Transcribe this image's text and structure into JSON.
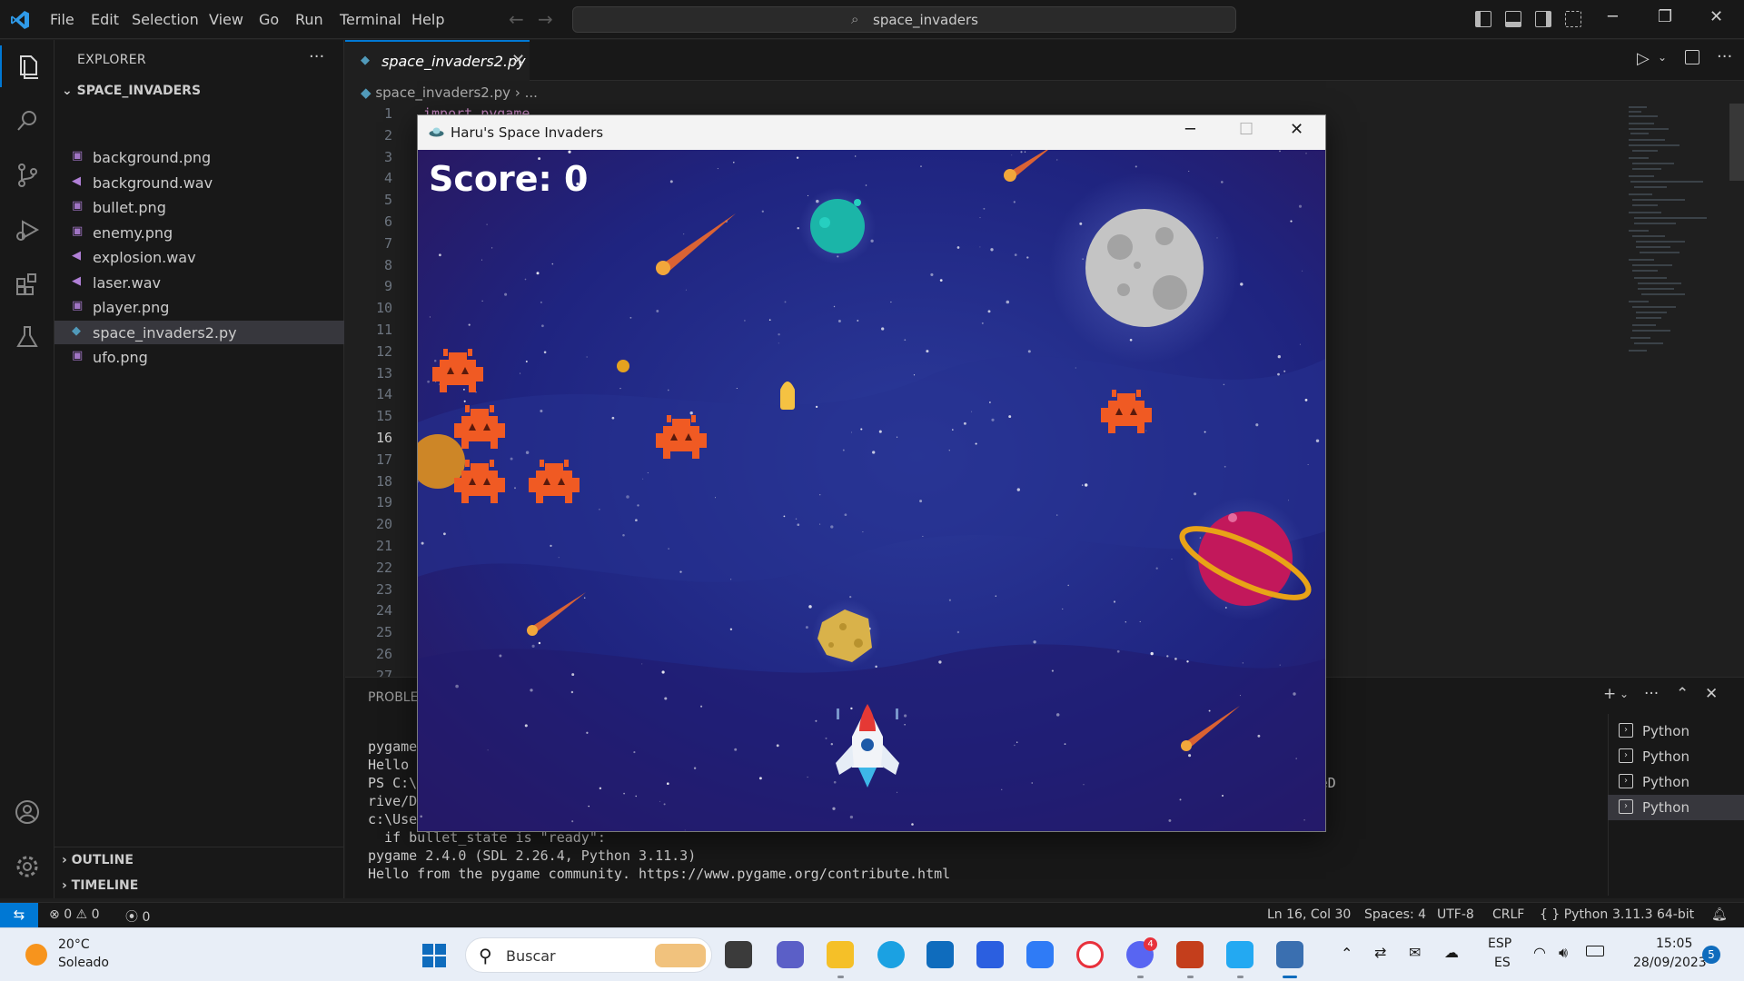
{
  "titlebar": {
    "menu": [
      "File",
      "Edit",
      "Selection",
      "View",
      "Go",
      "Run",
      "Terminal",
      "Help"
    ],
    "command_center": "space_invaders"
  },
  "sidebar": {
    "title": "EXPLORER",
    "folder": "SPACE_INVADERS",
    "files": [
      {
        "name": "background.png",
        "type": "image"
      },
      {
        "name": "background.wav",
        "type": "audio"
      },
      {
        "name": "bullet.png",
        "type": "image"
      },
      {
        "name": "enemy.png",
        "type": "image"
      },
      {
        "name": "explosion.wav",
        "type": "audio"
      },
      {
        "name": "laser.wav",
        "type": "audio"
      },
      {
        "name": "player.png",
        "type": "image"
      },
      {
        "name": "space_invaders2.py",
        "type": "python",
        "selected": true
      },
      {
        "name": "ufo.png",
        "type": "image"
      }
    ],
    "outline": "OUTLINE",
    "timeline": "TIMELINE"
  },
  "editor": {
    "tab": "space_invaders2.py",
    "breadcrumb_file": "space_invaders2.py",
    "breadcrumb_rest": "...",
    "line_numbers": [
      "1",
      "2",
      "3",
      "4",
      "5",
      "6",
      "7",
      "8",
      "9",
      "10",
      "11",
      "12",
      "13",
      "14",
      "15",
      "16",
      "17",
      "18",
      "19",
      "20",
      "21",
      "22",
      "23",
      "24",
      "25",
      "26",
      "27"
    ],
    "current_line": "16",
    "code_fragment": "import pygame"
  },
  "panel": {
    "title": "PROBLEMS",
    "terminal_lines": [
      "pygame",
      "Hello",
      "PS C:\\                                                                                 /python.exe c:/Users/harum/OneD",
      "rive/D",
      "c:\\Use                                                                                Did you mean \"==\"?",
      "  if bullet_state is \"ready\":",
      "pygame 2.4.0 (SDL 2.26.4, Python 3.11.3)",
      "Hello from the pygame community. https://www.pygame.org/contribute.html"
    ],
    "terminals": [
      "Python",
      "Python",
      "Python",
      "Python"
    ]
  },
  "statusbar": {
    "errors": "0",
    "warnings": "0",
    "ports": "0",
    "position": "Ln 16, Col 30",
    "spaces": "Spaces: 4",
    "encoding": "UTF-8",
    "eol": "CRLF",
    "language": "Python",
    "interpreter": "3.11.3 64-bit"
  },
  "game": {
    "title": "Haru's Space Invaders",
    "score": "Score: 0"
  },
  "taskbar": {
    "weather_temp": "20°C",
    "weather_cond": "Soleado",
    "search": "Buscar",
    "lang_top": "ESP",
    "lang_bottom": "ES",
    "time": "15:05",
    "date": "28/09/2023",
    "notifications": "5"
  },
  "colors": {
    "vscode_accent": "#0078d4",
    "game_bg_dark": "#1b1f6b",
    "enemy": "#f05a23"
  }
}
